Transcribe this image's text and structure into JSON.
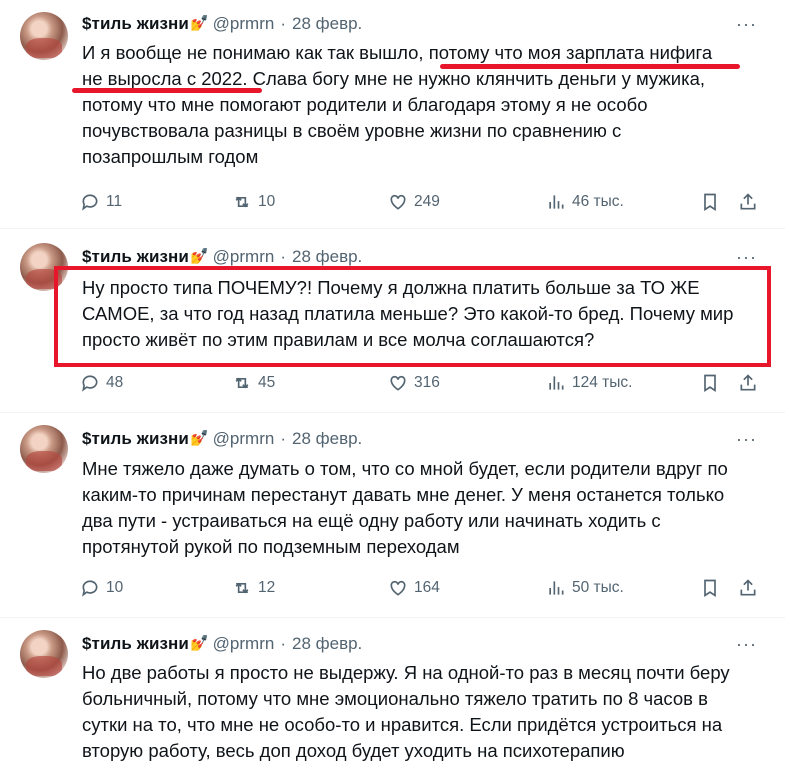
{
  "colors": {
    "text": "#0f1419",
    "secondary": "#536471",
    "highlight": "#e8162b",
    "separator": "#eff3f4"
  },
  "tweets": [
    {
      "name": "$тиль жизни",
      "name_emoji": "💅",
      "handle": "@prmrn",
      "dot": "·",
      "date": "28 февр.",
      "more": "···",
      "lines": [
        "И я вообще не понимаю как так вышло, потому что моя зарплата нифига",
        "не выросла с 2022. Слава богу мне не нужно клянчить деньги у мужика,",
        "потому что мне помогают родители и благодаря этому я не особо",
        "почувствовала разницы в своём уровне жизни по сравнению с",
        "позапрошлым годом"
      ],
      "replies": "11",
      "retweets": "10",
      "likes": "249",
      "views": "46 тыс."
    },
    {
      "name": "$тиль жизни",
      "name_emoji": "💅",
      "handle": "@prmrn",
      "dot": "·",
      "date": "28 февр.",
      "more": "···",
      "lines": [
        "Ну просто типа ПОЧЕМУ?! Почему я должна платить больше за ТО ЖЕ",
        "САМОЕ, за что год назад платила меньше? Это какой-то бред. Почему мир",
        "просто живёт по этим правилам и все молча соглашаются?"
      ],
      "replies": "48",
      "retweets": "45",
      "likes": "316",
      "views": "124 тыс."
    },
    {
      "name": "$тиль жизни",
      "name_emoji": "💅",
      "handle": "@prmrn",
      "dot": "·",
      "date": "28 февр.",
      "more": "···",
      "lines": [
        "Мне тяжело даже думать о том, что со мной будет, если родители вдруг по",
        "каким-то причинам перестанут давать мне денег. У меня останется только",
        "два пути - устраиваться на ещё одну работу или начинать ходить с",
        "протянутой рукой по подземным переходам"
      ],
      "replies": "10",
      "retweets": "12",
      "likes": "164",
      "views": "50 тыс."
    },
    {
      "name": "$тиль жизни",
      "name_emoji": "💅",
      "handle": "@prmrn",
      "dot": "·",
      "date": "28 февр.",
      "more": "···",
      "lines": [
        "Но две работы я просто не выдержу. Я на одной-то раз в месяц почти беру",
        "больничный, потому что мне эмоционально тяжело тратить по 8 часов в",
        "сутки на то, что мне не особо-то и нравится. Если придётся устроиться на",
        "вторую работу, весь доп доход будет уходить на психотерапию"
      ]
    }
  ],
  "icons": {
    "reply": "reply-icon",
    "retweet": "retweet-icon",
    "like": "heart-icon",
    "views": "views-icon",
    "bookmark": "bookmark-icon",
    "share": "share-icon"
  }
}
